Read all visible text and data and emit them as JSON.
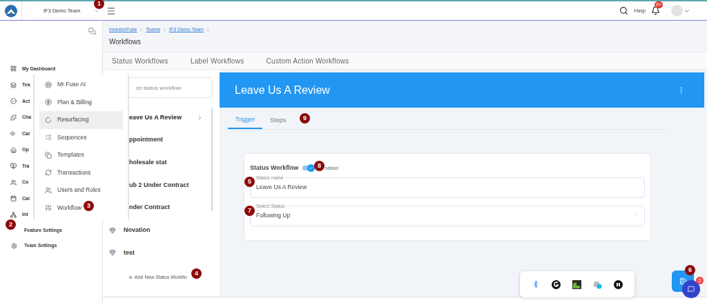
{
  "top_bar": {
    "team": "IF3 Demo Team",
    "help": "Help",
    "notification_badge": "9+"
  },
  "sidebar": {
    "items": [
      {
        "label": "My Dashboard"
      },
      {
        "label": "Tea"
      },
      {
        "label": "Act"
      },
      {
        "label": "Cha"
      },
      {
        "label": "Car"
      },
      {
        "label": "Op"
      },
      {
        "label": "Tra"
      },
      {
        "label": "Co"
      },
      {
        "label": "Cal"
      },
      {
        "label": "Int"
      }
    ],
    "bottom_items": [
      {
        "label": "Feature Settings"
      },
      {
        "label": "Team Settings"
      }
    ]
  },
  "menu": {
    "items": [
      {
        "label": "Mr Fuse AI",
        "selected": false
      },
      {
        "label": "Plan & Billing",
        "selected": false
      },
      {
        "label": "Resurfacing",
        "selected": true
      },
      {
        "label": "Sequences",
        "selected": false
      },
      {
        "label": "Templates",
        "selected": false
      },
      {
        "label": "Transactions",
        "selected": false
      },
      {
        "label": "Users and Roles",
        "selected": false
      },
      {
        "label": "Workflow",
        "selected": false
      }
    ]
  },
  "breadcrumbs": [
    "InvestorFuse",
    "Teams",
    "IF3 Demo Team"
  ],
  "page_title": "Workflows",
  "workflow_tabs": [
    {
      "label": "Status Workflows",
      "selected": false
    },
    {
      "label": "Label Workflows",
      "selected": false
    },
    {
      "label": "Custom Action Workflows",
      "selected": false
    }
  ],
  "workflow_list": {
    "search_placeholder": "ch status workflow",
    "items": [
      {
        "label": "eave Us A Review",
        "selected": true,
        "icon_shown": false
      },
      {
        "label": "ppointment",
        "selected": false,
        "icon_shown": false
      },
      {
        "label": "holesale stat",
        "selected": false,
        "icon_shown": false
      },
      {
        "label": "ub 2 Under Contract",
        "selected": false,
        "icon_shown": false
      },
      {
        "label": "nder Contract",
        "selected": false,
        "icon_shown": false
      },
      {
        "label": "Novation",
        "selected": false,
        "icon_shown": true
      },
      {
        "label": "test",
        "selected": false,
        "icon_shown": true
      }
    ],
    "add_button": "Add New Status Workflo"
  },
  "detail": {
    "title": "Leave Us A Review",
    "tabs": [
      {
        "label": "Trigger",
        "selected": true
      },
      {
        "label": "Steps",
        "selected": false
      }
    ],
    "card": {
      "heading": "Status Workflow",
      "toggle": {
        "label": "nabled",
        "on": true
      },
      "fields": [
        {
          "kind": "text",
          "label": "Status name",
          "value": "Leave Us A Review"
        },
        {
          "kind": "select",
          "label": "Select Status",
          "value": "Following Up"
        }
      ]
    }
  },
  "chat_badge": "2",
  "annotations": [
    "1",
    "2",
    "3",
    "4",
    "5",
    "6",
    "7",
    "8",
    "9"
  ]
}
